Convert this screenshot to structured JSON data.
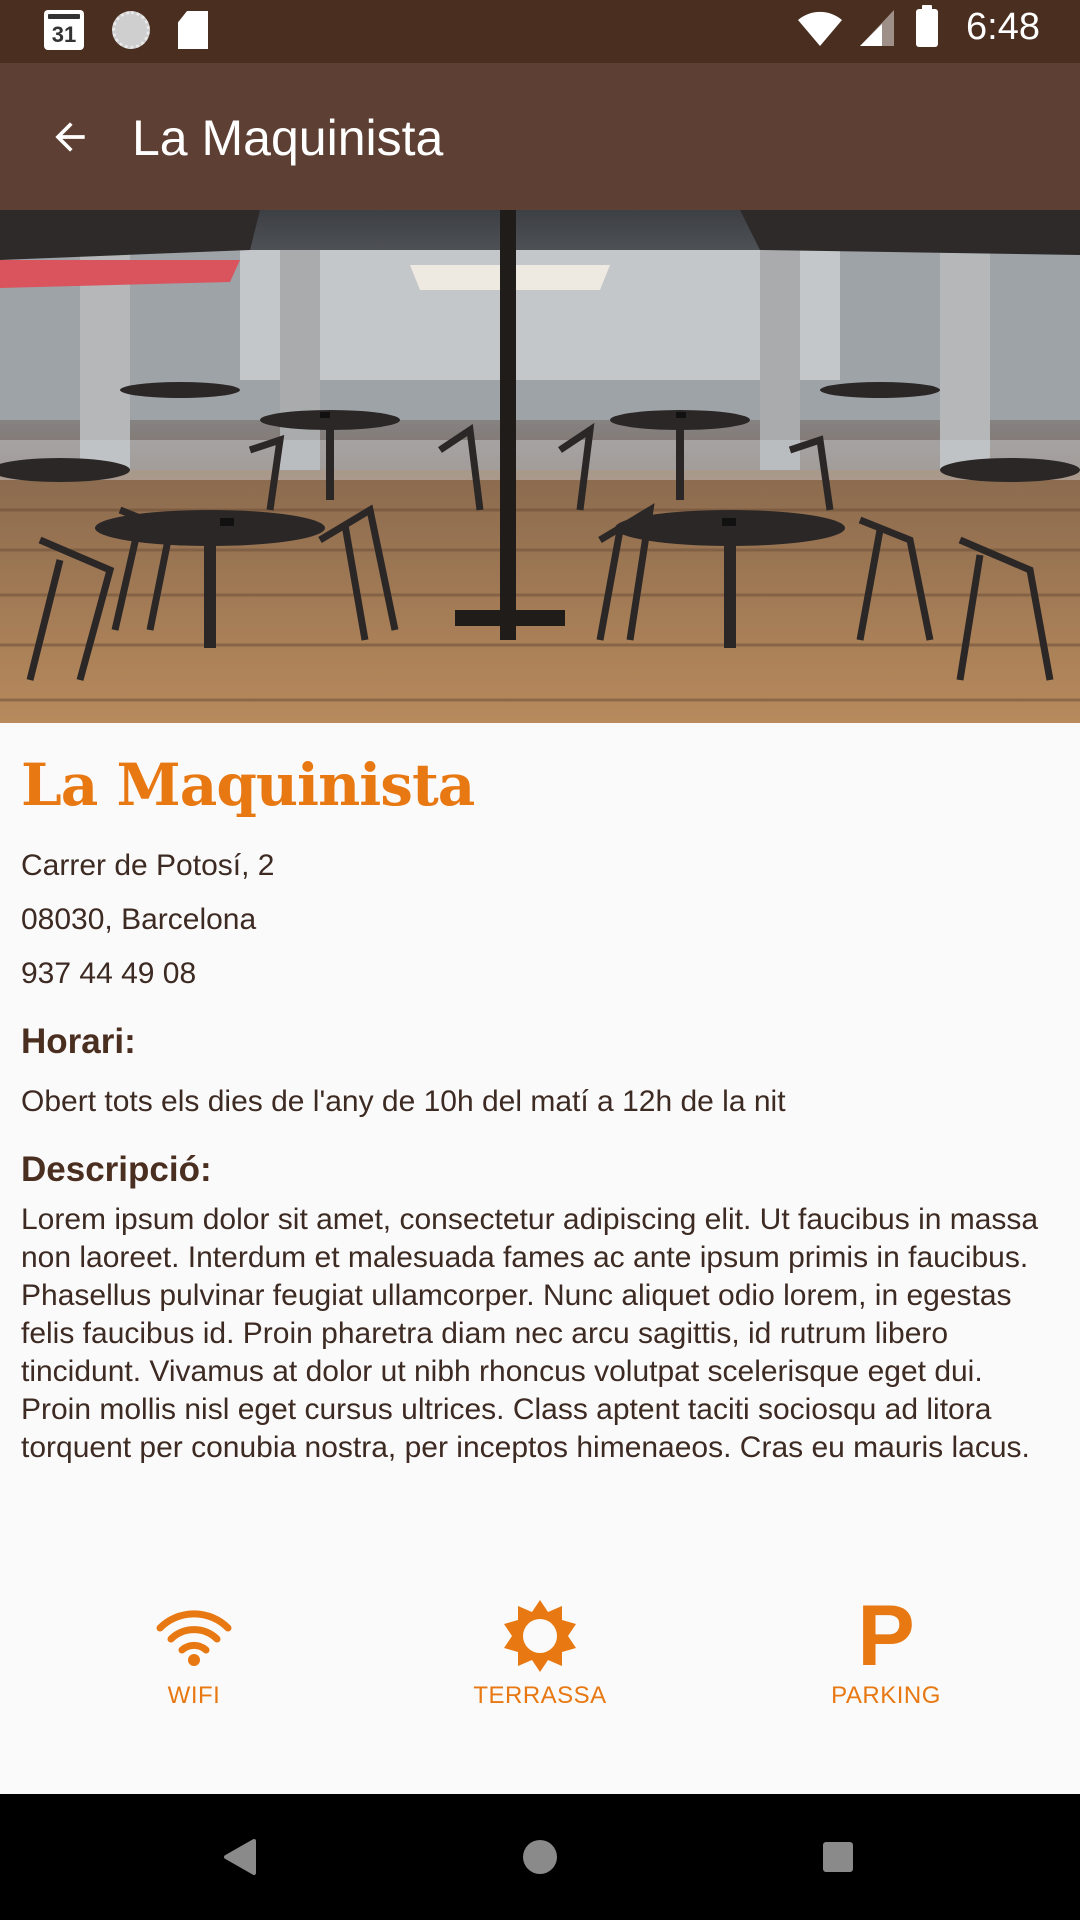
{
  "status_bar": {
    "time": "6:48",
    "calendar_day": "31",
    "icons": [
      "calendar-icon",
      "sync-icon",
      "sd-card-icon",
      "wifi-icon",
      "signal-icon",
      "battery-icon"
    ]
  },
  "app_bar": {
    "title": "La Maquinista",
    "back_icon": "arrow-back-icon"
  },
  "hero": {
    "image": "cafe-terrace-photo"
  },
  "place": {
    "name": "La Maquinista",
    "address_line1": "Carrer de Potosí, 2",
    "address_line2": "08030, Barcelona",
    "phone": "937 44 49 08",
    "schedule_title": "Horari:",
    "schedule_text": "Obert tots els dies de l'any de 10h del matí a 12h de la nit",
    "description_title": "Descripció:",
    "description_text": "Lorem ipsum dolor sit amet, consectetur adipiscing elit. Ut faucibus in massa non laoreet. Interdum et malesuada fames ac ante ipsum primis in faucibus. Phasellus pulvinar feugiat ullamcorper. Nunc aliquet odio lorem, in egestas felis faucibus id. Proin pharetra diam nec arcu sagittis, id rutrum libero tincidunt. Vivamus at dolor ut nibh rhoncus volutpat scelerisque eget dui. Proin mollis nisl eget cursus ultrices. Class aptent taciti sociosqu ad litora torquent per conubia nostra, per inceptos himenaeos. Cras eu mauris lacus."
  },
  "amenities": [
    {
      "label": "WIFI",
      "icon": "wifi-icon"
    },
    {
      "label": "TERRASSA",
      "icon": "sun-icon"
    },
    {
      "label": "PARKING",
      "icon": "parking-icon",
      "glyph": "P"
    }
  ],
  "nav_bar": {
    "icons": [
      "back-triangle-icon",
      "home-circle-icon",
      "recents-square-icon"
    ]
  },
  "colors": {
    "status_bar": "#4a2e20",
    "app_bar": "#5d4033",
    "accent": "#e87812",
    "text_primary": "#3d2a22",
    "background": "#fafafa"
  }
}
